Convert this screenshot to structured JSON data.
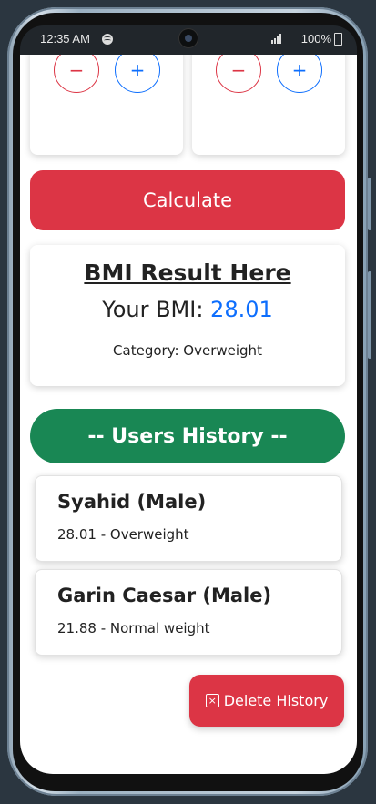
{
  "status_bar": {
    "time": "12:35 AM",
    "battery": "100%"
  },
  "steppers": [
    {
      "minus": "−",
      "plus": "+"
    },
    {
      "minus": "−",
      "plus": "+"
    }
  ],
  "calculate_label": "Calculate",
  "result": {
    "title": "BMI Result Here",
    "bmi_prefix": "Your BMI: ",
    "bmi_value": "28.01",
    "category_prefix": "Category: ",
    "category": "Overweight"
  },
  "history": {
    "header": "-- Users History --",
    "items": [
      {
        "name": "Syahid (Male)",
        "detail": "28.01 - Overweight"
      },
      {
        "name": "Garin Caesar (Male)",
        "detail": "21.88 - Normal weight"
      }
    ]
  },
  "delete_label": "Delete History",
  "colors": {
    "danger": "#dc3545",
    "primary": "#0d6efd",
    "success": "#198754"
  }
}
